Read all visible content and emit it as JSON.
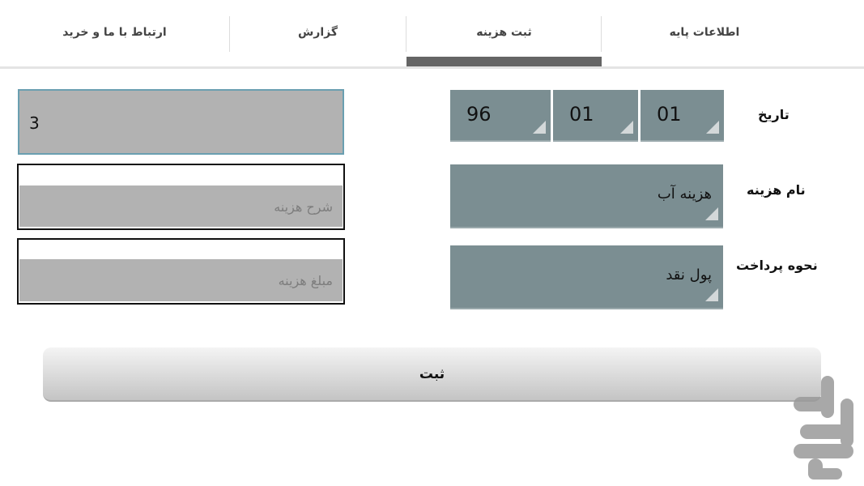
{
  "tabs": [
    {
      "label": "اطلاعات پایه",
      "active": false
    },
    {
      "label": "ثبت هزینه",
      "active": true
    },
    {
      "label": "گزارش",
      "active": false
    },
    {
      "label": "ارتباط با ما و خرید",
      "active": false
    }
  ],
  "form": {
    "date_label": "تاریخ",
    "date_year": "96",
    "date_month": "01",
    "date_day": "01",
    "expense_name_label": "نام هزینه",
    "expense_name_value": "هزینه آب",
    "payment_method_label": "نحوه پرداخت",
    "payment_method_value": "پول نقد",
    "number_field_value": "3",
    "description_placeholder": "شرح هزینه",
    "amount_placeholder": "مبلغ هزینه"
  },
  "submit_label": "ثبت",
  "colors": {
    "spinner_bg": "#7b8e92",
    "input_bg": "#b2b2b2",
    "tab_indicator": "#656565"
  }
}
